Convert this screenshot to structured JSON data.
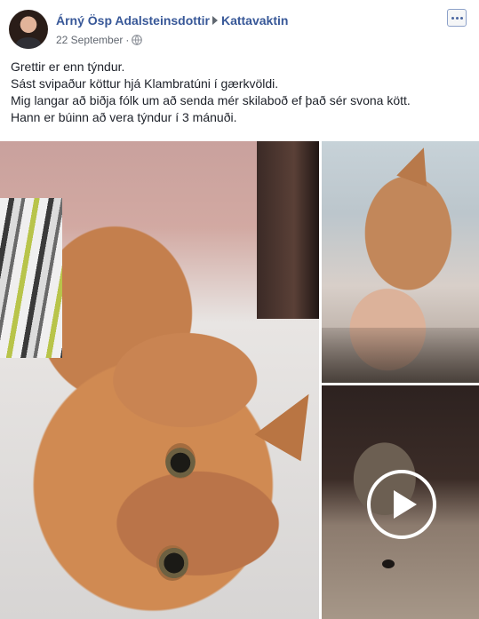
{
  "post": {
    "author": "Árný Ösp Adalsteinsdottir",
    "group": "Kattavaktin",
    "date": "22 September",
    "separator": "·",
    "privacy_icon": "globe-icon",
    "more_icon": "ellipsis-icon",
    "text_lines": [
      "Grettir er enn týndur.",
      "Sást svipaður köttur hjá Klambratúni í gærkvöldi.",
      "Mig langar að biðja fólk um að senda mér skilaboð ef það sér svona kött.",
      "Hann er búinn að vera týndur í 3 mánuði."
    ]
  },
  "media": {
    "photos": [
      "photo-main",
      "photo-top"
    ],
    "video_icon": "play-icon"
  },
  "colors": {
    "link": "#385898",
    "meta": "#616770",
    "text": "#1d2129"
  }
}
